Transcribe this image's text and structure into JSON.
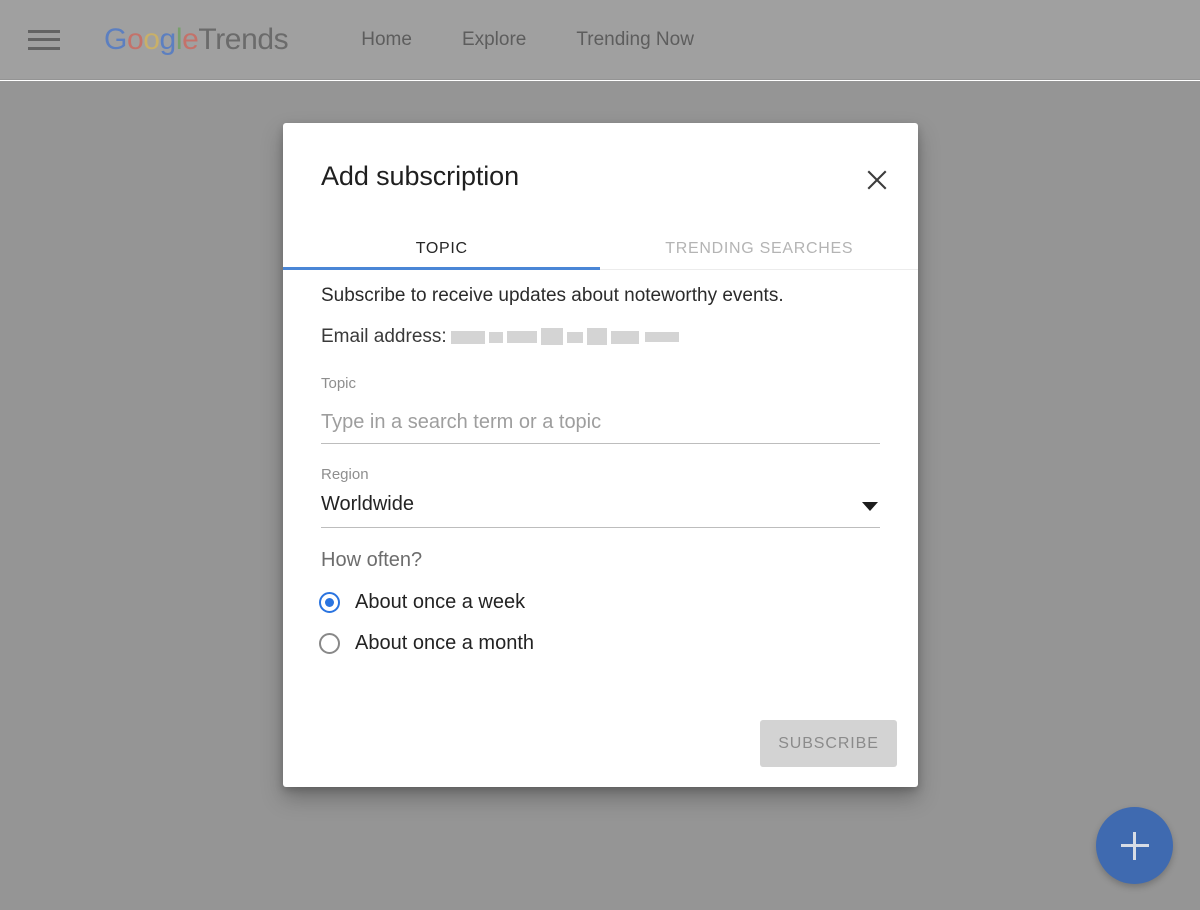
{
  "appbar": {
    "menu_icon": "hamburger-menu-icon",
    "brand": {
      "g1": "G",
      "o1": "o",
      "o2": "o",
      "g2": "g",
      "l1": "l",
      "e1": "e",
      "suffix": "Trends"
    },
    "nav": [
      {
        "label": "Home"
      },
      {
        "label": "Explore"
      },
      {
        "label": "Trending Now"
      }
    ]
  },
  "fab": {
    "icon": "plus-icon",
    "color": "#3f6ab0"
  },
  "dialog": {
    "title": "Add subscription",
    "close_icon": "close-x-icon",
    "tabs": [
      {
        "label": "TOPIC",
        "active": true
      },
      {
        "label": "TRENDING SEARCHES",
        "active": false
      }
    ],
    "accent_color": "#4a86d6",
    "intro": "Subscribe to receive updates about noteworthy events.",
    "email": {
      "label": "Email address:",
      "value_redacted": "[blurred]"
    },
    "topic": {
      "label": "Topic",
      "placeholder": "Type in a search term or a topic",
      "value": ""
    },
    "region": {
      "label": "Region",
      "selected": "Worldwide",
      "caret_icon": "chevron-down-icon"
    },
    "frequency": {
      "label": "How often?",
      "options": [
        {
          "label": "About once a week",
          "selected": true
        },
        {
          "label": "About once a month",
          "selected": false
        }
      ]
    },
    "submit": {
      "label": "SUBSCRIBE",
      "disabled": true
    }
  }
}
